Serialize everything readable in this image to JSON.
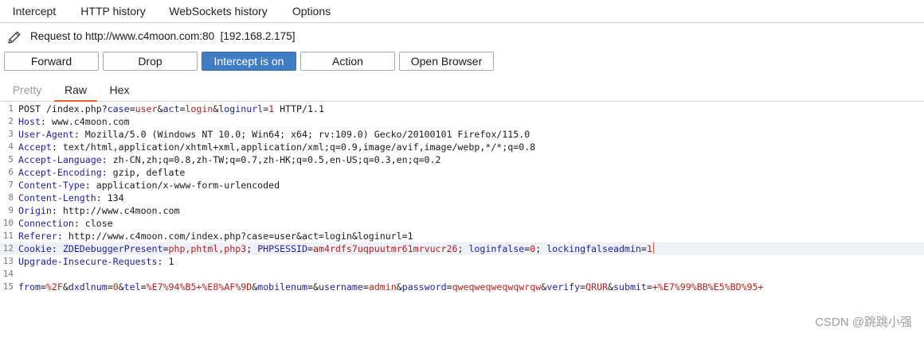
{
  "tabs": [
    {
      "label": "Intercept",
      "active": true
    },
    {
      "label": "HTTP history",
      "active": false
    },
    {
      "label": "WebSockets history",
      "active": false
    },
    {
      "label": "Options",
      "active": false
    }
  ],
  "request_info": {
    "text": "Request to http://www.c4moon.com:80  [192.168.2.175]",
    "icon": "pencil-icon"
  },
  "toolbar": {
    "forward": "Forward",
    "drop": "Drop",
    "intercept": "Intercept is on",
    "action": "Action",
    "open_browser": "Open Browser"
  },
  "view_tabs": [
    {
      "label": "Pretty",
      "active": false
    },
    {
      "label": "Raw",
      "active": true
    },
    {
      "label": "Hex",
      "active": false
    }
  ],
  "colors": {
    "accent": "#e8602c",
    "intercept_on": "#3f7dc4",
    "header_key": "#1f1f9e",
    "param_value": "#b41e1e"
  },
  "request_lines": [
    {
      "n": "1",
      "tokens": [
        [
          "POST /index.php?",
          "p"
        ],
        [
          "case",
          "k"
        ],
        [
          "=",
          "p"
        ],
        [
          "user",
          "v"
        ],
        [
          "&",
          "p"
        ],
        [
          "act",
          "k"
        ],
        [
          "=",
          "p"
        ],
        [
          "login",
          "v"
        ],
        [
          "&",
          "p"
        ],
        [
          "loginurl",
          "k"
        ],
        [
          "=",
          "p"
        ],
        [
          "1",
          "v"
        ],
        [
          " HTTP/1.1",
          "p"
        ]
      ]
    },
    {
      "n": "2",
      "tokens": [
        [
          "Host",
          "k"
        ],
        [
          ": www.c4moon.com",
          "p"
        ]
      ]
    },
    {
      "n": "3",
      "tokens": [
        [
          "User-Agent",
          "k"
        ],
        [
          ": Mozilla/5.0 (Windows NT 10.0; Win64; x64; rv:109.0) Gecko/20100101 Firefox/115.0",
          "p"
        ]
      ]
    },
    {
      "n": "4",
      "tokens": [
        [
          "Accept",
          "k"
        ],
        [
          ": text/html,application/xhtml+xml,application/xml;q=0.9,image/avif,image/webp,*/*;q=0.8",
          "p"
        ]
      ]
    },
    {
      "n": "5",
      "tokens": [
        [
          "Accept-Language",
          "k"
        ],
        [
          ": zh-CN,zh;q=0.8,zh-TW;q=0.7,zh-HK;q=0.5,en-US;q=0.3,en;q=0.2",
          "p"
        ]
      ]
    },
    {
      "n": "6",
      "tokens": [
        [
          "Accept-Encoding",
          "k"
        ],
        [
          ": gzip, deflate",
          "p"
        ]
      ]
    },
    {
      "n": "7",
      "tokens": [
        [
          "Content-Type",
          "k"
        ],
        [
          ": application/x-www-form-urlencoded",
          "p"
        ]
      ]
    },
    {
      "n": "8",
      "tokens": [
        [
          "Content-Length",
          "k"
        ],
        [
          ": 134",
          "p"
        ]
      ]
    },
    {
      "n": "9",
      "tokens": [
        [
          "Origin",
          "k"
        ],
        [
          ": http://www.c4moon.com",
          "p"
        ]
      ]
    },
    {
      "n": "10",
      "tokens": [
        [
          "Connection",
          "k"
        ],
        [
          ": close",
          "p"
        ]
      ]
    },
    {
      "n": "11",
      "tokens": [
        [
          "Referer",
          "k"
        ],
        [
          ": http://www.c4moon.com/index.php?case=user&act=login&loginurl=1",
          "p"
        ]
      ]
    },
    {
      "n": "12",
      "current": true,
      "tokens": [
        [
          "Cookie",
          "k"
        ],
        [
          ": ",
          "p"
        ],
        [
          "ZDEDebuggerPresent",
          "k"
        ],
        [
          "=",
          "p"
        ],
        [
          "php,phtml,php3",
          "v"
        ],
        [
          "; ",
          "p"
        ],
        [
          "PHPSESSID",
          "k"
        ],
        [
          "=",
          "p"
        ],
        [
          "am4rdfs7uqpuutmr61mrvucr26",
          "v"
        ],
        [
          "; ",
          "p"
        ],
        [
          "loginfalse",
          "k"
        ],
        [
          "=",
          "p"
        ],
        [
          "0",
          "v"
        ],
        [
          "; ",
          "p"
        ],
        [
          "lockingfalseadmin",
          "k"
        ],
        [
          "=",
          "p"
        ],
        [
          "1",
          "v"
        ]
      ]
    },
    {
      "n": "13",
      "tokens": [
        [
          "Upgrade-Insecure-Requests",
          "k"
        ],
        [
          ": 1",
          "p"
        ]
      ]
    },
    {
      "n": "14",
      "tokens": []
    },
    {
      "n": "15",
      "tokens": [
        [
          "from",
          "k"
        ],
        [
          "=",
          "p"
        ],
        [
          "%2F",
          "v"
        ],
        [
          "&",
          "p"
        ],
        [
          "dxdlnum",
          "k"
        ],
        [
          "=",
          "p"
        ],
        [
          "0",
          "v"
        ],
        [
          "&",
          "p"
        ],
        [
          "tel",
          "k"
        ],
        [
          "=",
          "p"
        ],
        [
          "%E7%94%B5+%E8%AF%9D",
          "v"
        ],
        [
          "&",
          "p"
        ],
        [
          "mobilenum",
          "k"
        ],
        [
          "=",
          "p"
        ],
        [
          "&",
          "p"
        ],
        [
          "username",
          "k"
        ],
        [
          "=",
          "p"
        ],
        [
          "admin",
          "v"
        ],
        [
          "&",
          "p"
        ],
        [
          "password",
          "k"
        ],
        [
          "=",
          "p"
        ],
        [
          "qweqweqweqwqwrqw",
          "v"
        ],
        [
          "&",
          "p"
        ],
        [
          "verify",
          "k"
        ],
        [
          "=",
          "p"
        ],
        [
          "QRUR",
          "v"
        ],
        [
          "&",
          "p"
        ],
        [
          "submit",
          "k"
        ],
        [
          "=",
          "p"
        ],
        [
          "+%E7%99%BB%E5%BD%95+",
          "v"
        ]
      ]
    }
  ],
  "watermark": "CSDN @跳跳小强"
}
